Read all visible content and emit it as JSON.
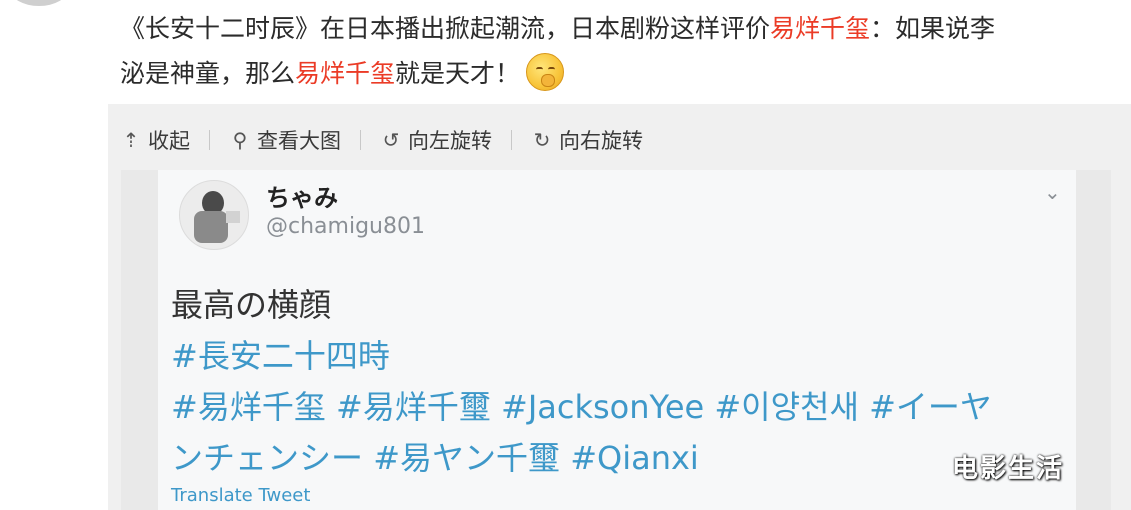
{
  "post": {
    "line1_part1": "《长安十二时辰》在日本播出掀起潮流，日本剧粉这样评价",
    "line1_highlight": "易烊千玺",
    "line1_part2": "：如果说李",
    "line2_part1": "泌是神童，那么",
    "line2_highlight": "易烊千玺",
    "line2_part2": "就是天才！",
    "emoji_icon": "thinking-face-emoji",
    "highlight_color": "#eb3b26"
  },
  "toolbar": {
    "collapse_label": "收起",
    "collapse_icon": "upload-arrow-icon",
    "view_large_label": "查看大图",
    "view_large_icon": "magnifier-icon",
    "rotate_left_label": "向左旋转",
    "rotate_left_icon": "rotate-left-icon",
    "rotate_right_label": "向右旋转",
    "rotate_right_icon": "rotate-right-icon"
  },
  "tweet": {
    "display_name": "ちゃみ",
    "handle": "@chamigu801",
    "text_line1": "最高の横顔",
    "tag_1": "#長安二十四時",
    "tag_2": "#易烊千玺",
    "tag_3": "#易烊千璽",
    "tag_4": "#JacksonYee",
    "tag_5": "#이양천새",
    "tag_6a": "#イーヤ",
    "tag_6b": "ンチェンシー",
    "tag_7": "#易ヤン千璽",
    "tag_8": "#Qianxi",
    "translate_label": "Translate Tweet",
    "hashtag_color": "#3e98c9"
  },
  "watermark": "电影生活"
}
